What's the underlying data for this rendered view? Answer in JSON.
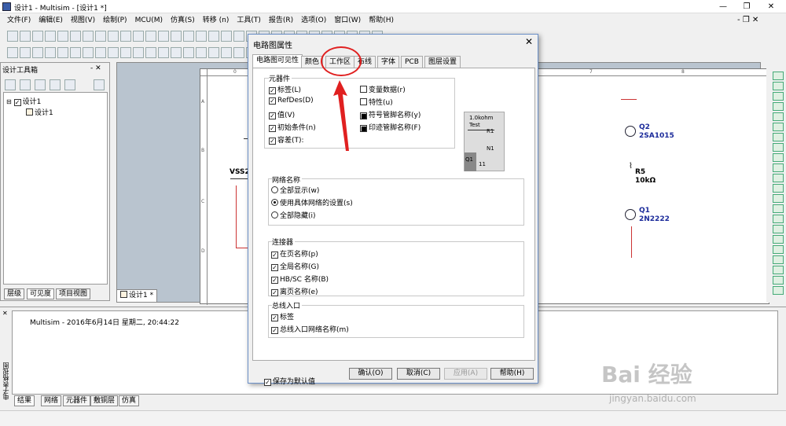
{
  "window": {
    "title": "设计1 - Multisim - [设计1 *]"
  },
  "menu": [
    "文件(F)",
    "编辑(E)",
    "视图(V)",
    "绘制(P)",
    "MCU(M)",
    "仿真(S)",
    "转移 (n)",
    "工具(T)",
    "报告(R)",
    "选项(O)",
    "窗口(W)",
    "帮助(H)"
  ],
  "left_panel": {
    "title": "设计工具箱",
    "tree": {
      "root": "设计1",
      "child": "设计1"
    },
    "tabs": [
      "层级",
      "可见度",
      "项目视图"
    ]
  },
  "workspace": {
    "tab": "设计1 *",
    "ruler_top": [
      "0",
      "7",
      "8"
    ],
    "ruler_left": [
      "A",
      "B",
      "C",
      "D"
    ],
    "parts": {
      "vss_label": "VSS2",
      "vss_value": "5",
      "q2_ref": "Q2",
      "q2_val": "2SA1015",
      "r5_ref": "R5",
      "r5_val": "10kΩ",
      "q1_ref": "Q1",
      "q1_val": "2N2222"
    }
  },
  "bottom": {
    "log": "Multisim  -  2016年6月14日 星期二, 20:44:22",
    "side_label": "电子表格视图",
    "tabs": [
      "结果",
      "网络",
      "元器件",
      "敷铜层",
      "仿真"
    ]
  },
  "dialog": {
    "title": "电路图属性",
    "tabs": [
      "电路图可见性",
      "颜色",
      "工作区",
      "布线",
      "字体",
      "PCB",
      "图层设置"
    ],
    "active_tab": "电路图可见性",
    "components_group": {
      "title": "元器件",
      "left": [
        {
          "label": "标签(L)",
          "checked": true
        },
        {
          "label": "RefDes(D)",
          "checked": true
        },
        {
          "label": "值(V)",
          "checked": true
        },
        {
          "label": "初始条件(n)",
          "checked": true
        },
        {
          "label": "容差(T):",
          "checked": true
        }
      ],
      "right": [
        {
          "label": "变量数据(r)",
          "checked": false
        },
        {
          "label": "特性(u)",
          "checked": false
        },
        {
          "label": "符号管脚名称(y)",
          "checked": true,
          "filled": true
        },
        {
          "label": "印迹管脚名称(F)",
          "checked": true,
          "filled": true
        }
      ],
      "preview": {
        "value": "1.0kohm",
        "test": "Test",
        "r1": "R1",
        "n1": "N1",
        "q1": "Q1",
        "n11": "11"
      }
    },
    "net_names_group": {
      "title": "网络名称",
      "options": [
        {
          "label": "全部显示(w)",
          "selected": false
        },
        {
          "label": "使用具体网络的设置(s)",
          "selected": true
        },
        {
          "label": "全部隐藏(i)",
          "selected": false
        }
      ]
    },
    "connectors_group": {
      "title": "连接器",
      "items": [
        {
          "label": "在页名称(p)",
          "checked": true
        },
        {
          "label": "全局名称(G)",
          "checked": true
        },
        {
          "label": "HB/SC 名称(B)",
          "checked": true
        },
        {
          "label": "离页名称(e)",
          "checked": true
        }
      ]
    },
    "bus_entry_group": {
      "title": "总线入口",
      "items": [
        {
          "label": "标签",
          "checked": true
        },
        {
          "label": "总线入口网络名称(m)",
          "checked": true
        }
      ]
    },
    "save_default": {
      "label": "保存为默认值",
      "checked": true
    },
    "buttons": {
      "ok": "确认(O)",
      "cancel": "取消(C)",
      "apply": "应用(A)",
      "help": "帮助(H)"
    }
  },
  "watermark": {
    "main": "Bai 经验",
    "sub": "jingyan.baidu.com"
  },
  "colors": {
    "annotation": "#e02020",
    "part_label": "#1a2a9a",
    "workspace_bg": "#b9c4cf"
  }
}
